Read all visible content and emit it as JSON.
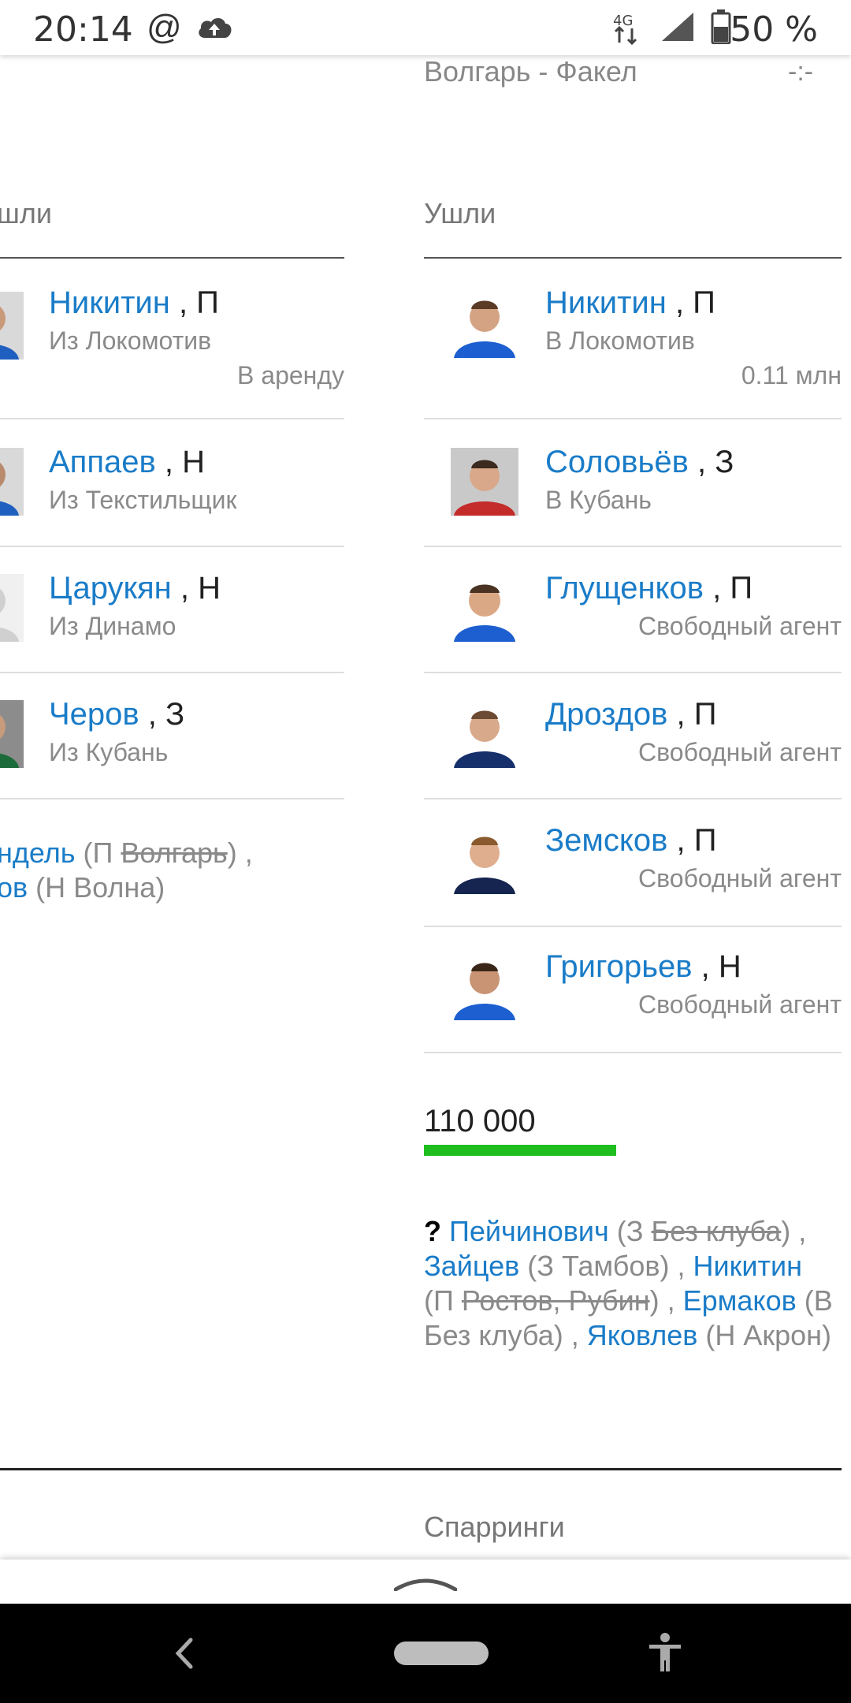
{
  "status_bar": {
    "time": "20:14",
    "icons": [
      "at-icon",
      "cloud-upload-icon",
      "network-4g-icon",
      "signal-icon",
      "battery-icon"
    ],
    "network": "4G",
    "battery": "50 %"
  },
  "match": {
    "teams": "Волгарь - Факел",
    "score": "-:-"
  },
  "left_column": {
    "title": "шли",
    "players": [
      {
        "name": "Никитин",
        "pos": " , П",
        "sub": "Из Локомотив",
        "note": "В аренду"
      },
      {
        "name": "Аппаев",
        "pos": " , Н",
        "sub": "Из Текстильщик",
        "note": ""
      },
      {
        "name": "Царукян",
        "pos": " , Н",
        "sub": "Из Динамо",
        "note": ""
      },
      {
        "name": "Черов",
        "pos": " , З",
        "sub": "Из Кубань",
        "note": ""
      }
    ],
    "rumors": {
      "r1_name": "ндель",
      "r1_pre": " (П ",
      "r1_strike": "Волгарь",
      "r1_post": ") ,",
      "r2_name": "ов",
      "r2_rest": " (Н Волна)"
    }
  },
  "right_column": {
    "title": "Ушли",
    "players": [
      {
        "name": "Никитин",
        "pos": " , П",
        "sub": "В Локомотив",
        "note": "0.11 млн"
      },
      {
        "name": "Соловьёв",
        "pos": " , З",
        "sub": "В Кубань",
        "note": ""
      },
      {
        "name": "Глущенков",
        "pos": " , П",
        "sub": "",
        "note": "Свободный агент"
      },
      {
        "name": "Дроздов",
        "pos": " , П",
        "sub": "",
        "note": "Свободный агент"
      },
      {
        "name": "Земсков",
        "pos": " , П",
        "sub": "",
        "note": "Свободный агент"
      },
      {
        "name": "Григорьев",
        "pos": " , Н",
        "sub": "",
        "note": "Свободный агент"
      }
    ],
    "money": "110 000",
    "rumors": {
      "q": "?",
      "n1": "Пейчинович",
      "n1_pre": " (З ",
      "n1_strike": "Без клуба",
      "n1_post": ") ,",
      "n2": "Зайцев",
      "n2_rest": " (З Тамбов) ,",
      "n3": "Никитин",
      "n3_pre": "(П ",
      "n3_strike": "Ростов, Рубин",
      "n3_post": ") ,",
      "n4": "Ермаков",
      "n4_rest": " (В Без клуба) ,",
      "n5": "Яковлев",
      "n5_rest": " (Н Акрон)"
    }
  },
  "sparrings_title": "Спарринги"
}
